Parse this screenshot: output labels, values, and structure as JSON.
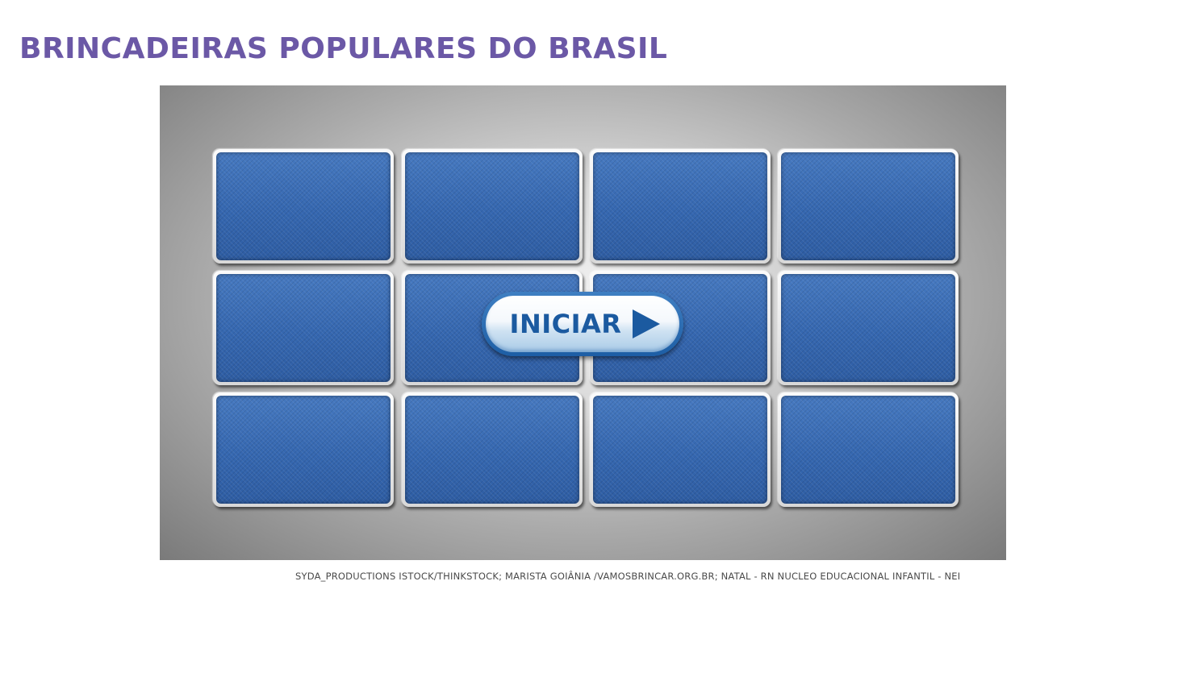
{
  "page": {
    "title": "BRINCADEIRAS POPULARES DO BRASIL",
    "credits": "SYDA_PRODUCTIONS ISTOCK/THINKSTOCK; MARISTA GOIÂNIA /VAMOSBRINCAR.ORG.BR; NATAL - RN NUCLEO EDUCACIONAL INFANTIL - NEI"
  },
  "game": {
    "type": "memory-card-grid",
    "rows": 3,
    "columns": 4,
    "cards_face_down": 12,
    "start_button": {
      "label": "INICIAR",
      "icon": "play-icon"
    }
  },
  "colors": {
    "title": "#6b58a6",
    "card_back": "#3a6db5",
    "start_button_text": "#1b5aa0"
  }
}
